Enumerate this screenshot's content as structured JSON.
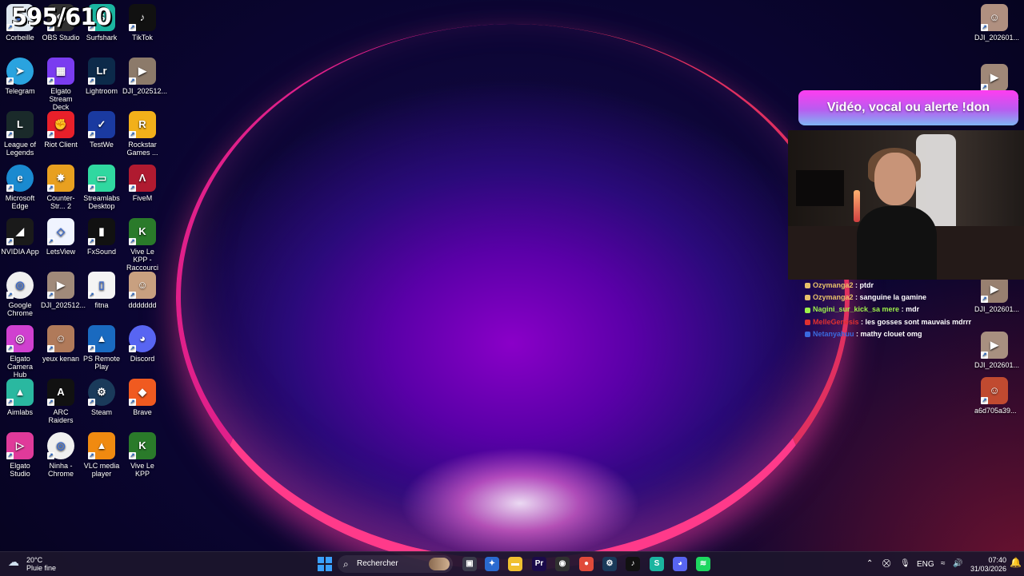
{
  "overlay": {
    "counter": "595/610",
    "donation_banner": "Vidéo, vocal ou alerte !don"
  },
  "chat": [
    {
      "user": "Ozymanga2",
      "message": "ptdr",
      "user_color": "#e8c26a"
    },
    {
      "user": "Ozymanga2",
      "message": "sanguine la gamine",
      "user_color": "#e8c26a"
    },
    {
      "user": "Nagini_sur_kick_sa mere",
      "message": "mdr",
      "user_color": "#9cf04a"
    },
    {
      "user": "MelleGenesis",
      "message": "les gosses sont mauvais mdrrr",
      "user_color": "#e03030"
    },
    {
      "user": "Netanyahuu",
      "message": "mathy clouet omg",
      "user_color": "#3a6adf"
    }
  ],
  "desktop_left": [
    {
      "label": "Corbeille",
      "icon": "recycle-bin-icon",
      "color": "#dfe8f0"
    },
    {
      "label": "OBS Studio",
      "icon": "obs-icon",
      "color": "#303030"
    },
    {
      "label": "Surfshark",
      "icon": "surfshark-icon",
      "color": "#1bb5a0"
    },
    {
      "label": "TikTok",
      "icon": "tiktok-icon",
      "color": "#111111"
    },
    {
      "label": "Telegram",
      "icon": "telegram-icon",
      "color": "#2aa3df"
    },
    {
      "label": "Elgato Stream Deck",
      "icon": "stream-deck-icon",
      "color": "#7a3cf0"
    },
    {
      "label": "Lightroom",
      "icon": "lightroom-icon",
      "color": "#0c2a4a"
    },
    {
      "label": "DJI_202512...",
      "icon": "video-thumbnail-icon",
      "color": "#8c7a6a"
    },
    {
      "label": "League of Legends",
      "icon": "league-of-legends-icon",
      "color": "#1a2a2a"
    },
    {
      "label": "Riot Client",
      "icon": "riot-client-icon",
      "color": "#e8202a"
    },
    {
      "label": "TestWe",
      "icon": "testwe-icon",
      "color": "#1a3aa0"
    },
    {
      "label": "Rockstar Games ...",
      "icon": "rockstar-icon",
      "color": "#f2b01a"
    },
    {
      "label": "Microsoft Edge",
      "icon": "edge-icon",
      "color": "#1a8ad0"
    },
    {
      "label": "Counter-Str... 2",
      "icon": "counter-strike-icon",
      "color": "#e8a020"
    },
    {
      "label": "Streamlabs Desktop",
      "icon": "streamlabs-icon",
      "color": "#30d8a0"
    },
    {
      "label": "FiveM",
      "icon": "fivem-icon",
      "color": "#b01a30"
    },
    {
      "label": "NVIDIA App",
      "icon": "nvidia-icon",
      "color": "#1a1a1a"
    },
    {
      "label": "LetsView",
      "icon": "letsview-icon",
      "color": "#f0f4ff"
    },
    {
      "label": "FxSound",
      "icon": "fxsound-icon",
      "color": "#111111"
    },
    {
      "label": "Vive Le KPP - Raccourci",
      "icon": "kpp-icon",
      "color": "#2a7a2a"
    },
    {
      "label": "Google Chrome",
      "icon": "chrome-icon",
      "color": "#f0f0f0"
    },
    {
      "label": "DJI_202512...",
      "icon": "video-thumbnail-icon",
      "color": "#a08a7a"
    },
    {
      "label": "fitna",
      "icon": "file-icon",
      "color": "#f4f4f4"
    },
    {
      "label": "ddddddd",
      "icon": "photo-thumbnail-icon",
      "color": "#c8a080"
    },
    {
      "label": "Elgato Camera Hub",
      "icon": "camera-hub-icon",
      "color": "#d040d0"
    },
    {
      "label": "yeux kenan",
      "icon": "photo-thumbnail-icon",
      "color": "#b07a5a"
    },
    {
      "label": "PS Remote Play",
      "icon": "ps-remote-play-icon",
      "color": "#1a6ac0"
    },
    {
      "label": "Discord",
      "icon": "discord-icon",
      "color": "#5865f2"
    },
    {
      "label": "Aimlabs",
      "icon": "aimlabs-icon",
      "color": "#2ab8a0"
    },
    {
      "label": "ARC Raiders",
      "icon": "arc-raiders-icon",
      "color": "#111111"
    },
    {
      "label": "Steam",
      "icon": "steam-icon",
      "color": "#1a3a5a"
    },
    {
      "label": "Brave",
      "icon": "brave-icon",
      "color": "#f05a20"
    },
    {
      "label": "Elgato Studio",
      "icon": "elgato-studio-icon",
      "color": "#e03a9a"
    },
    {
      "label": "Ninha - Chrome",
      "icon": "chrome-profile-icon",
      "color": "#f0f0f0"
    },
    {
      "label": "VLC media player",
      "icon": "vlc-icon",
      "color": "#f08a10"
    },
    {
      "label": "Vive Le KPP",
      "icon": "kpp-icon",
      "color": "#2a7a2a"
    }
  ],
  "desktop_right": [
    {
      "label": "DJI_202601...",
      "icon": "photo-thumbnail-icon",
      "color": "#b09080"
    },
    {
      "label": "DJI_202601...",
      "icon": "video-thumbnail-icon",
      "color": "#a08878"
    },
    {
      "label": "DJI_202601...",
      "icon": "video-thumbnail-icon",
      "color": "#988070"
    },
    {
      "label": "DJI_202601...",
      "icon": "video-thumbnail-icon",
      "color": "#a89080"
    },
    {
      "label": "a6d705a39...",
      "icon": "photo-thumbnail-icon",
      "color": "#c04a30"
    }
  ],
  "taskbar": {
    "weather_temp": "20°C",
    "weather_condition": "Pluie fine",
    "search_placeholder": "Rechercher",
    "language": "ENG",
    "time": "07:40",
    "date": "31/03/2026",
    "apps": [
      {
        "name": "task-view-icon",
        "glyph": "▣",
        "color": "#3a3a4a"
      },
      {
        "name": "copilot-icon",
        "glyph": "✦",
        "color": "#2a6ad0"
      },
      {
        "name": "file-explorer-icon",
        "glyph": "▬",
        "color": "#f0c030"
      },
      {
        "name": "premiere-icon",
        "glyph": "Pr",
        "color": "#1a0a4a"
      },
      {
        "name": "obs-taskbar-icon",
        "glyph": "◉",
        "color": "#303030"
      },
      {
        "name": "chrome-taskbar-icon",
        "glyph": "●",
        "color": "#e04a3a"
      },
      {
        "name": "steam-taskbar-icon",
        "glyph": "⚙",
        "color": "#1a3a5a"
      },
      {
        "name": "tiktok-taskbar-icon",
        "glyph": "♪",
        "color": "#111111"
      },
      {
        "name": "surfshark-taskbar-icon",
        "glyph": "S",
        "color": "#1bb5a0"
      },
      {
        "name": "discord-taskbar-icon",
        "glyph": "◕",
        "color": "#5865f2"
      },
      {
        "name": "spotify-taskbar-icon",
        "glyph": "≋",
        "color": "#1ed760"
      }
    ]
  }
}
